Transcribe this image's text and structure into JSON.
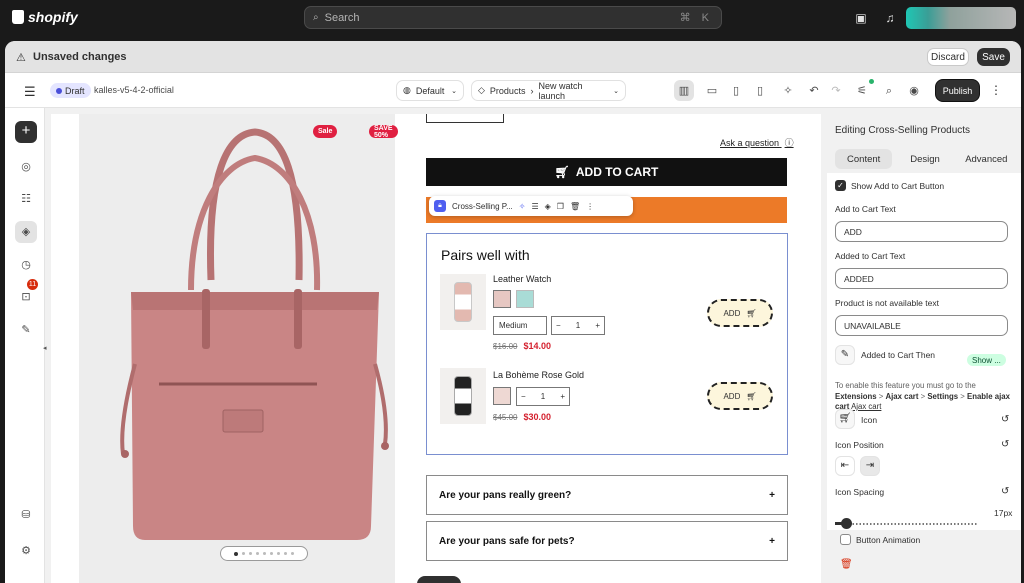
{
  "topbar": {
    "brand": "shopify",
    "search_placeholder": "Search",
    "search_shortcut": "⌘ K"
  },
  "unsaved_bar": {
    "label": "Unsaved changes",
    "discard": "Discard",
    "save": "Save"
  },
  "editor_toolbar": {
    "status": "Draft",
    "theme_name": "kalles-v5-4-2-official",
    "template_select": "Default",
    "breadcrumb": [
      "Products",
      "New watch launch"
    ],
    "publish": "Publish"
  },
  "rail": {
    "notification_count": "11"
  },
  "canvas": {
    "badges": [
      "Sale",
      "SAVE 50%"
    ],
    "ask_question": "Ask a question",
    "add_to_cart": "ADD TO CART",
    "section_toolbar_label": "Cross-Selling P...",
    "pairs_title": "Pairs well with",
    "products": [
      {
        "name": "Leather Watch",
        "swatches": [
          "#e6c7c2",
          "#a9dcd6"
        ],
        "variant": "Medium",
        "qty": "1",
        "price_old": "$16.00",
        "price_new": "$14.00",
        "button": "ADD"
      },
      {
        "name": "La Bohème Rose Gold",
        "swatches": [
          "#eed8d3"
        ],
        "qty": "1",
        "price_old": "$45.00",
        "price_new": "$30.00",
        "button": "ADD"
      }
    ],
    "faq": [
      "Are your pans really green?",
      "Are your pans safe for pets?"
    ]
  },
  "panel": {
    "title": "Editing Cross-Selling Products",
    "tabs": [
      "Content",
      "Design",
      "Advanced"
    ],
    "active_tab": "Content",
    "show_add_to_cart": {
      "label": "Show Add to Cart Button",
      "checked": true
    },
    "add_to_cart_text": {
      "label": "Add to Cart Text",
      "value": "ADD"
    },
    "added_to_cart_text": {
      "label": "Added to Cart Text",
      "value": "ADDED"
    },
    "unavailable_text": {
      "label": "Product is not available text",
      "value": "UNAVAILABLE"
    },
    "added_then": {
      "label": "Added to Cart Then",
      "badge": "Show ..."
    },
    "enable_note": {
      "prefix": "To enable this feature you must go to the",
      "path": [
        "Extensions",
        "Ajax cart",
        "Settings"
      ],
      "enable": "Enable ajax cart",
      "link": "Ajax cart"
    },
    "icon": {
      "label": "Icon"
    },
    "icon_position": {
      "label": "Icon Position"
    },
    "icon_spacing": {
      "label": "Icon Spacing",
      "value": "17px",
      "fraction": 0.08
    },
    "button_animation": {
      "label": "Button Animation",
      "checked": false
    }
  },
  "colors": {
    "accent": "#303030",
    "brand_orange": "#ec7a28",
    "sale_red": "#e02041",
    "bag_pink": "#c98585"
  }
}
